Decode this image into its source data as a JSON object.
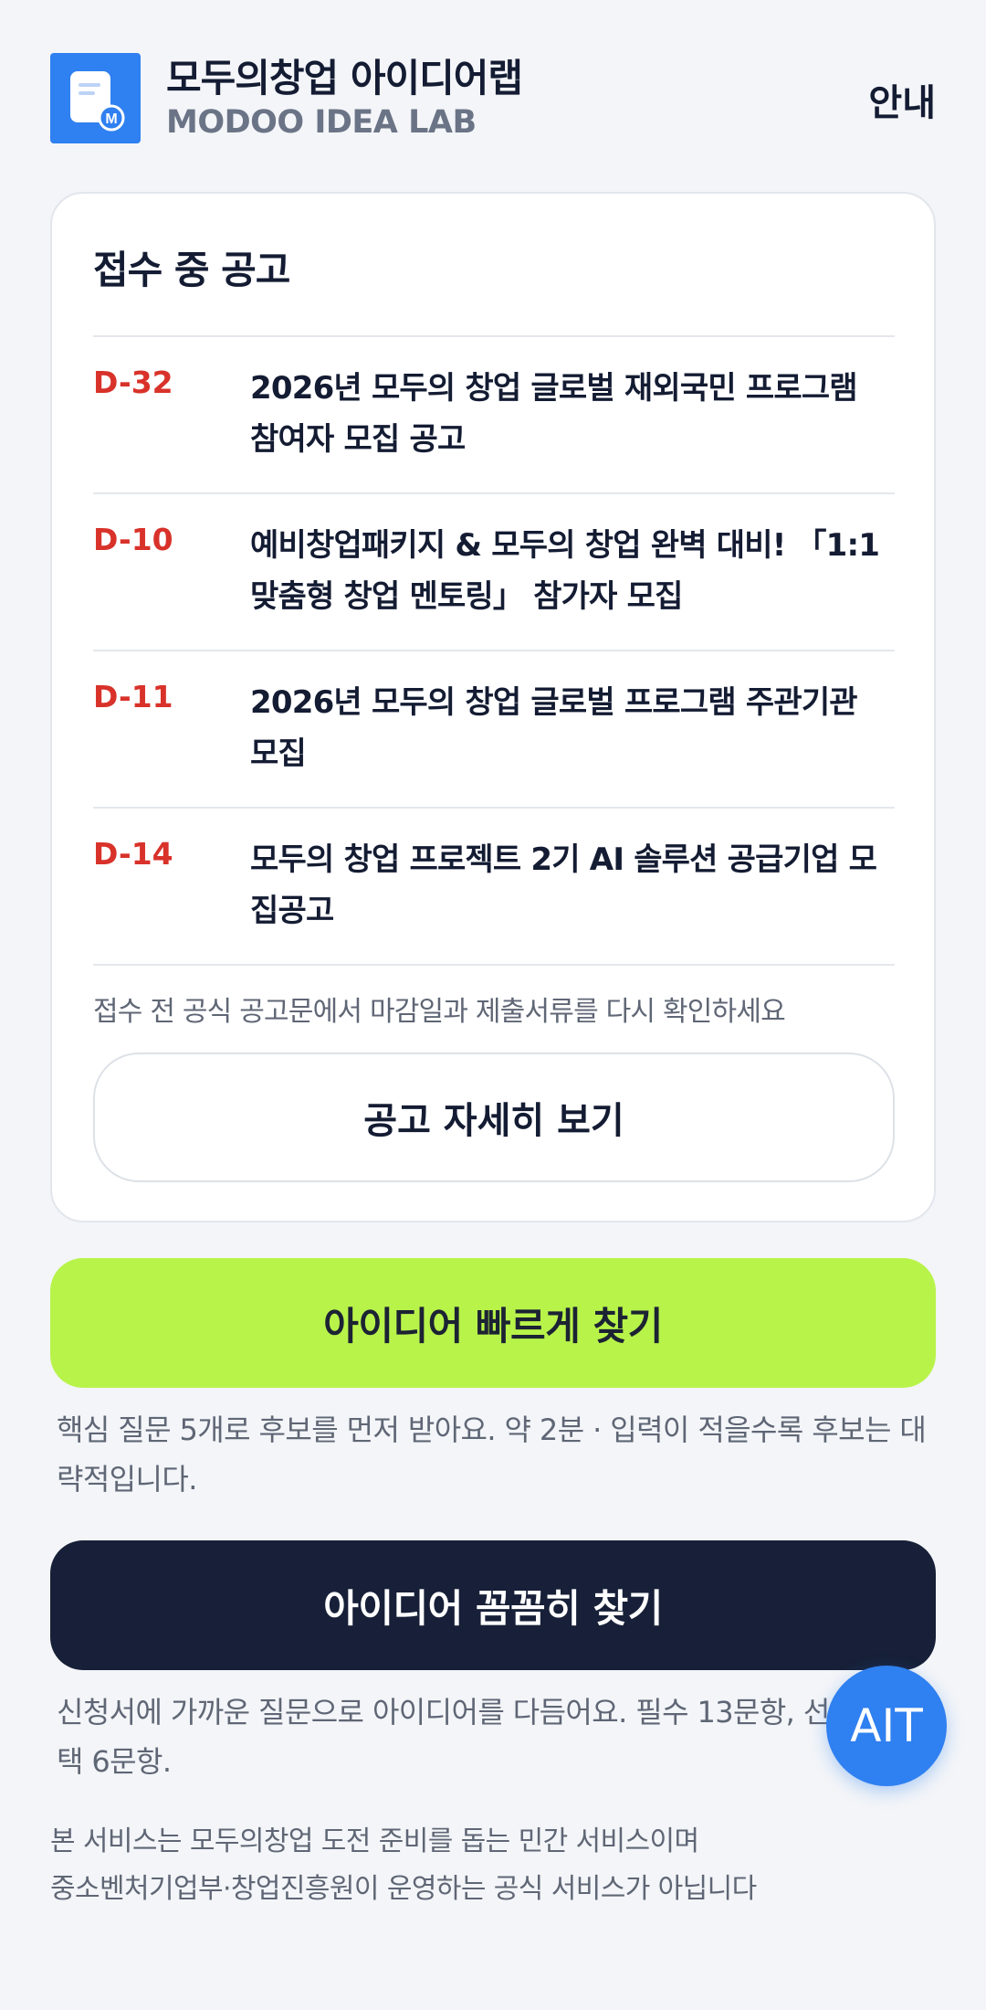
{
  "header": {
    "brand_title": "모두의창업 아이디어랩",
    "brand_subtitle": "MODOO IDEA LAB",
    "nav_guide": "안내",
    "logo_icon": "document-icon",
    "logo_badge": "M"
  },
  "notices": {
    "title": "접수 중 공고",
    "items": [
      {
        "dday": "D-32",
        "title": "2026년 모두의 창업 글로벌 재외국민 프로그램 참여자 모집 공고"
      },
      {
        "dday": "D-10",
        "title": "예비창업패키지 & 모두의 창업 완벽 대비! 「1:1 맞춤형 창업 멘토링」 참가자 모집"
      },
      {
        "dday": "D-11",
        "title": "2026년 모두의 창업 글로벌 프로그램 주관기관 모집"
      },
      {
        "dday": "D-14",
        "title": "모두의 창업 프로젝트 2기 AI 솔루션 공급기업 모집공고"
      }
    ],
    "caution": "접수 전 공식 공고문에서 마감일과 제출서류를 다시 확인하세요",
    "detail_button": "공고 자세히 보기"
  },
  "quick_find": {
    "label": "아이디어 빠르게 찾기",
    "description": "핵심 질문 5개로 후보를 먼저 받아요. 약 2분 · 입력이 적을수록 후보는 대략적입니다."
  },
  "detail_find": {
    "label": "아이디어 꼼꼼히 찾기",
    "description": "신청서에 가까운 질문으로 아이디어를 다듬어요. 필수 13문항, 선택 6문항."
  },
  "disclaimer": {
    "line1": "본 서비스는 모두의창업 도전 준비를 돕는 민간 서비스이며",
    "line2": "중소벤처기업부·창업진흥원이 운영하는 공식 서비스가 아닙니다"
  },
  "fab": {
    "label": "AIT"
  },
  "colors": {
    "accent_blue": "#2f80f0",
    "dday_red": "#d8322a",
    "lime": "#b8f34a",
    "navy": "#172038"
  }
}
